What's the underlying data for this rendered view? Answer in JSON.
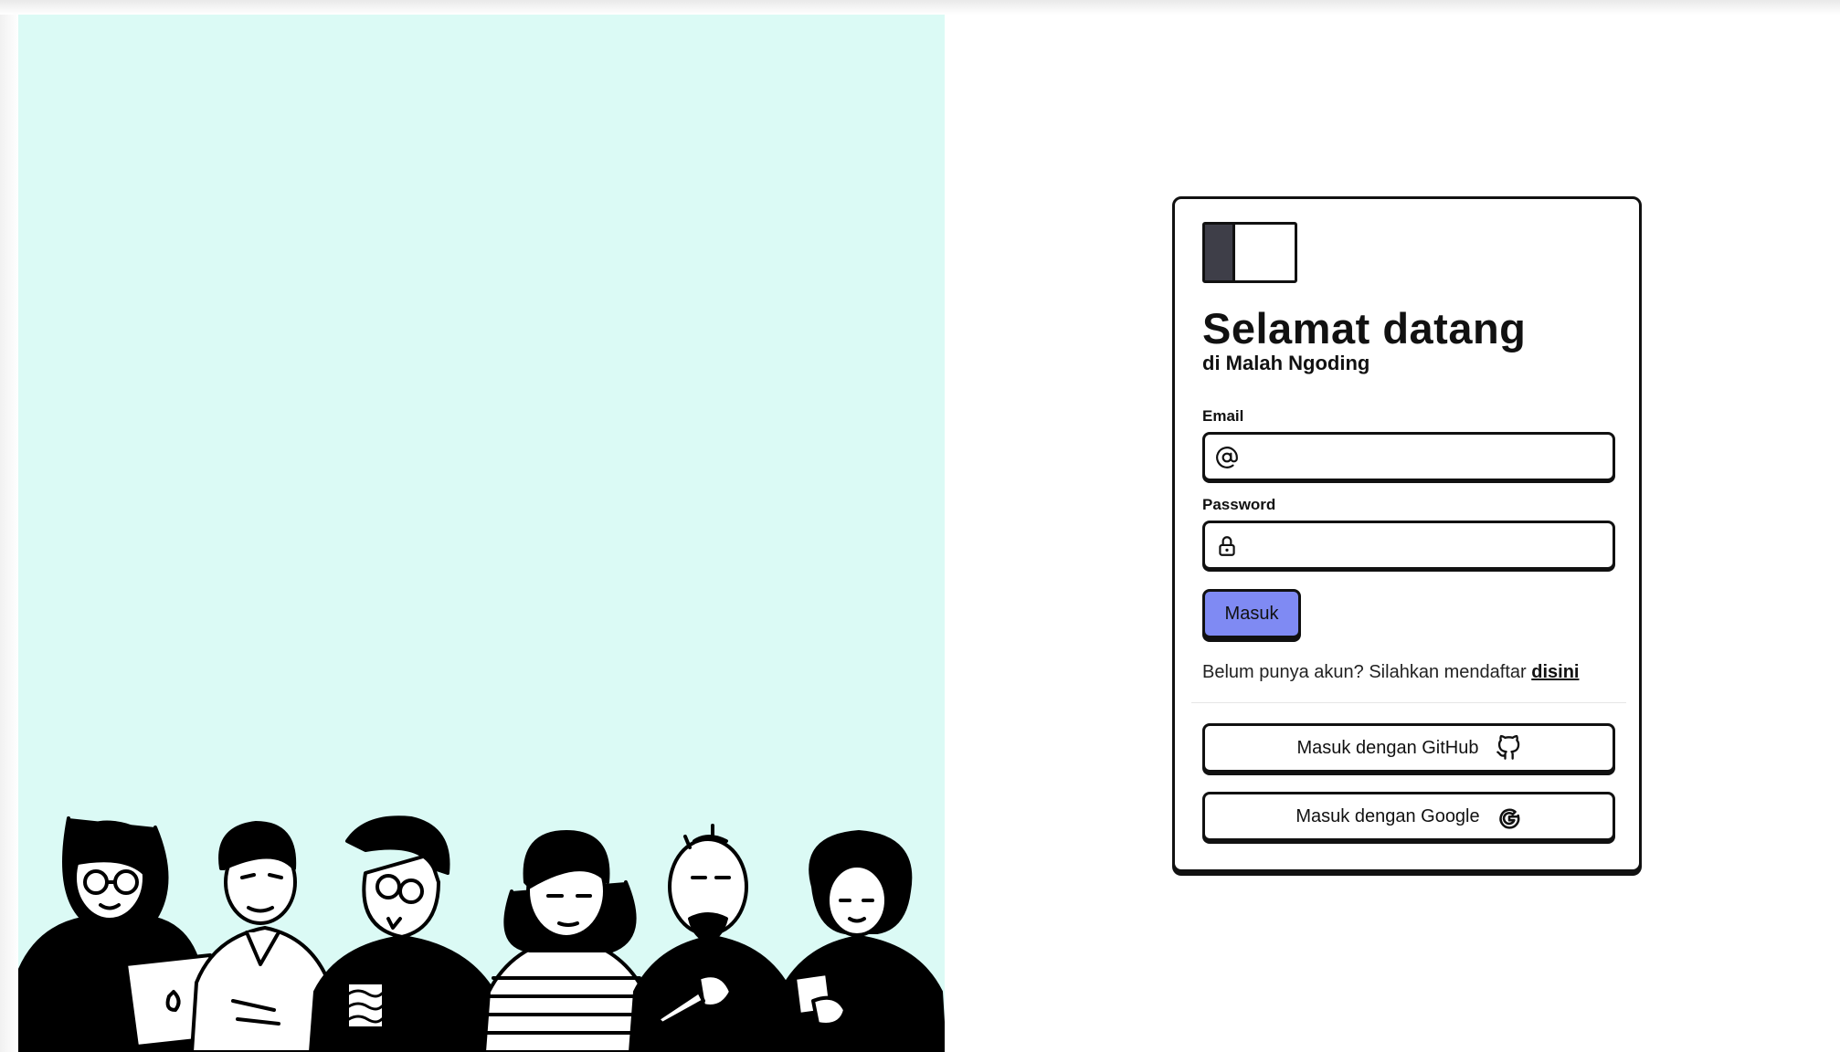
{
  "login": {
    "title": "Selamat datang",
    "subtitle": "di Malah Ngoding",
    "email_label": "Email",
    "email_value": "",
    "email_icon": "at-icon",
    "password_label": "Password",
    "password_value": "",
    "password_icon": "lock-icon",
    "submit_label": "Masuk",
    "register_text": "Belum punya akun? Silahkan mendaftar",
    "register_link": "disini",
    "github_label": "Masuk dengan GitHub",
    "github_icon": "github-icon",
    "google_label": "Masuk dengan Google",
    "google_icon": "google-icon"
  },
  "colors": {
    "hero_background": "#dbfaf5",
    "primary_button": "#7f8af3",
    "border": "#111111"
  }
}
